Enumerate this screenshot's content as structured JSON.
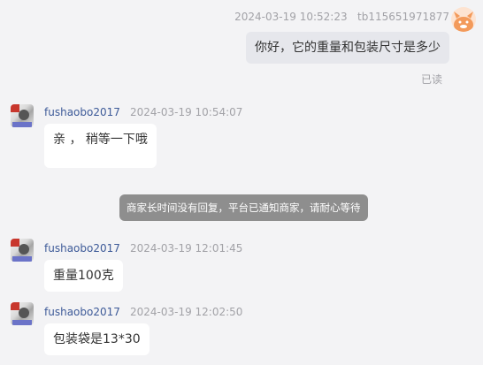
{
  "messages": [
    {
      "side": "right",
      "timestamp": "2024-03-19 10:52:23",
      "sender": "tb115651971877",
      "text": "你好，它的重量和包装尺寸是多少",
      "status": "已读"
    },
    {
      "side": "left",
      "sender": "fushaobo2017",
      "timestamp": "2024-03-19 10:54:07",
      "text": "亲 ， 稍等一下哦"
    },
    {
      "side": "left",
      "sender": "fushaobo2017",
      "timestamp": "2024-03-19 12:01:45",
      "text": "重量100克"
    },
    {
      "side": "left",
      "sender": "fushaobo2017",
      "timestamp": "2024-03-19 12:02:50",
      "text": "包装袋是13*30"
    }
  ],
  "system_notice": "商家长时间没有回复，平台已通知商家，请耐心等待",
  "colors": {
    "background": "#f3f3f5",
    "shop_name": "#3d5a98",
    "system_bg": "#8e8e8e"
  }
}
